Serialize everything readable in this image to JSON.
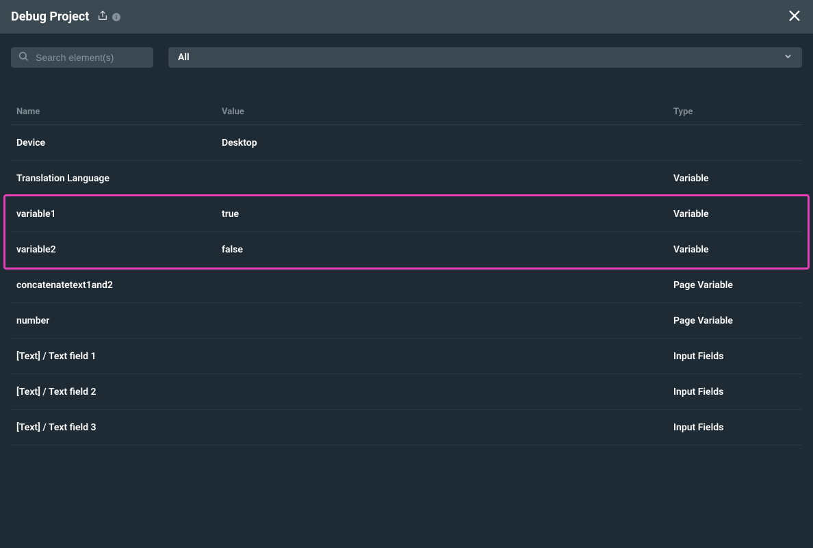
{
  "header": {
    "title": "Debug Project"
  },
  "search": {
    "placeholder": "Search element(s)"
  },
  "filter": {
    "selected": "All"
  },
  "columns": {
    "name": "Name",
    "value": "Value",
    "type": "Type"
  },
  "rows": [
    {
      "name": "Device",
      "value": "Desktop",
      "type": ""
    },
    {
      "name": "Translation Language",
      "value": "",
      "type": "Variable"
    },
    {
      "name": "variable1",
      "value": "true",
      "type": "Variable"
    },
    {
      "name": "variable2",
      "value": "false",
      "type": "Variable"
    },
    {
      "name": "concatenatetext1and2",
      "value": "",
      "type": "Page Variable"
    },
    {
      "name": "number",
      "value": "",
      "type": "Page Variable"
    },
    {
      "name": "[Text] / Text field 1",
      "value": "",
      "type": "Input Fields"
    },
    {
      "name": "[Text] / Text field 2",
      "value": "",
      "type": "Input Fields"
    },
    {
      "name": "[Text] / Text field 3",
      "value": "",
      "type": "Input Fields"
    }
  ]
}
